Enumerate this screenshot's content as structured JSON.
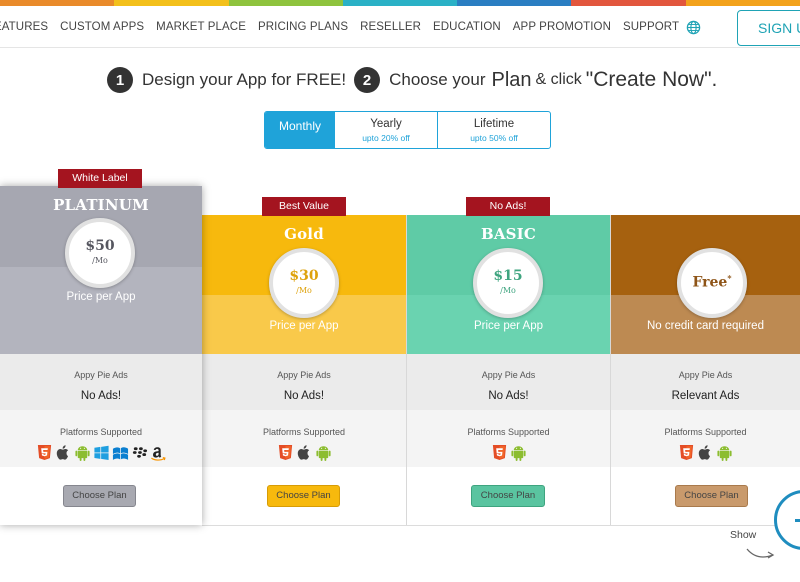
{
  "strip_colors": [
    "#e98a2a",
    "#f3c01b",
    "#8ec33d",
    "#2ab1c6",
    "#2a7ec2",
    "#e2563d",
    "#f3a21b"
  ],
  "nav": {
    "items": [
      "EATURES",
      "CUSTOM APPS",
      "MARKET PLACE",
      "PRICING PLANS",
      "RESELLER",
      "EDUCATION",
      "APP PROMOTION",
      "SUPPORT"
    ],
    "signup_label": "SIGN U",
    "globe_icon": "globe-icon"
  },
  "headline": {
    "step1_num": "1",
    "step1_text": "Design your App for FREE!",
    "step2_num": "2",
    "step2_choose": "Choose your",
    "step2_plan": "Plan",
    "step2_click": "& click",
    "step2_create": "\"Create Now\"."
  },
  "billing": {
    "monthly": "Monthly",
    "yearly": "Yearly",
    "yearly_sub": "upto 20% off",
    "lifetime": "Lifetime",
    "lifetime_sub": "upto 50% off",
    "active": "Monthly"
  },
  "plans": [
    {
      "ribbon": "White Label",
      "name": "PLATINUM",
      "price": "$50",
      "per": "/Mo",
      "price_label": "Price per App",
      "ads_label": "Appy Pie Ads",
      "ads_value": "No Ads!",
      "platforms_label": "Platforms Supported",
      "platform_icons": [
        "html5-icon",
        "apple-icon",
        "android-icon",
        "windows-icon",
        "windows-phone-icon",
        "blackberry-icon",
        "amazon-icon"
      ],
      "button": "Choose Plan",
      "colors": {
        "top": "#a6a7b1",
        "bottom": "#b3b4be",
        "accent": "#55565f"
      }
    },
    {
      "ribbon": "Best Value",
      "name": "Gold",
      "price": "$30",
      "per": "/Mo",
      "price_label": "Price per App",
      "ads_label": "Appy Pie Ads",
      "ads_value": "No Ads!",
      "platforms_label": "Platforms Supported",
      "platform_icons": [
        "html5-icon",
        "apple-icon",
        "android-icon"
      ],
      "button": "Choose Plan",
      "colors": {
        "top": "#f7b90d",
        "bottom": "#f9c94a",
        "accent": "#dea20b"
      }
    },
    {
      "ribbon": "No Ads!",
      "name": "BASIC",
      "price": "$15",
      "per": "/Mo",
      "price_label": "Price per App",
      "ads_label": "Appy Pie Ads",
      "ads_value": "No Ads!",
      "platforms_label": "Platforms Supported",
      "platform_icons": [
        "html5-icon",
        "android-icon"
      ],
      "button": "Choose Plan",
      "colors": {
        "top": "#5fcba6",
        "bottom": "#6ad3b0",
        "accent": "#3ea47f"
      }
    },
    {
      "ribbon": "",
      "name": "",
      "price": "Free",
      "price_mark": "*",
      "per": "",
      "price_label": "No credit card required",
      "ads_label": "Appy Pie Ads",
      "ads_value": "Relevant Ads",
      "platforms_label": "Platforms Supported",
      "platform_icons": [
        "html5-icon",
        "apple-icon",
        "android-icon"
      ],
      "button": "Choose Plan",
      "colors": {
        "top": "#a6610f",
        "bottom": "#bd8a52",
        "accent": "#8e5417"
      }
    }
  ],
  "show_label": "Show"
}
